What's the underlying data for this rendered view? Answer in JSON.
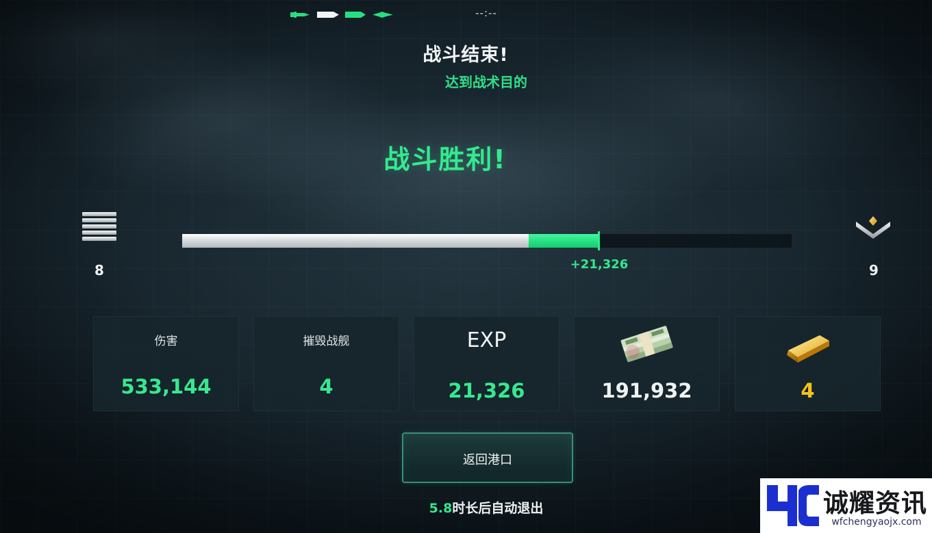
{
  "header": {
    "timer": "--:--",
    "title": "战斗结束!",
    "subtitle": "达到战术目的"
  },
  "result": {
    "victory_text": "战斗胜利!"
  },
  "progress": {
    "current_level": "8",
    "next_level": "9",
    "base_fraction": 0.569,
    "gain_fraction": 0.116,
    "gain_label": "+21,326",
    "accent_color": "#22e07f"
  },
  "stats": [
    {
      "label": "伤害",
      "value": "533,144"
    },
    {
      "label": "摧毁战舰",
      "value": "4"
    },
    {
      "label": "EXP",
      "value": "21,326"
    },
    {
      "icon": "cash-stack-icon",
      "value": "191,932"
    },
    {
      "icon": "gold-bar-icon",
      "value": "4"
    }
  ],
  "actions": {
    "return_button": "返回港口",
    "auto_exit_seconds": "5.8",
    "auto_exit_text": "时长后自动退出"
  },
  "watermark": {
    "title": "诚耀资讯",
    "url": "wfchengyaojx.com"
  }
}
